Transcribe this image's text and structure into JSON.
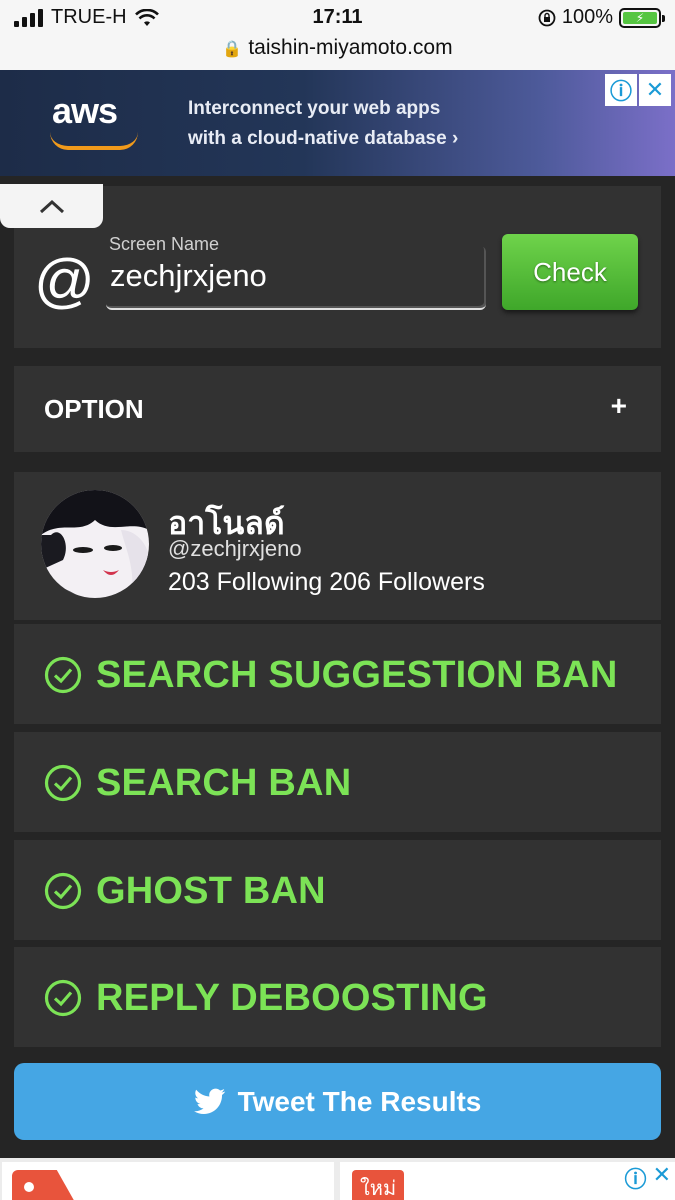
{
  "status_bar": {
    "carrier": "TRUE-H",
    "time": "17:11",
    "battery": "100%",
    "url": "taishin-miyamoto.com"
  },
  "ad_top": {
    "brand": "aws",
    "line1": "Interconnect your web apps",
    "line2": "with a cloud-native database ›",
    "info_icon": "info-icon",
    "close_icon": "close-icon"
  },
  "search": {
    "at_symbol": "@",
    "label": "Screen Name",
    "value": "zechjrxjeno",
    "check_label": "Check"
  },
  "option": {
    "label": "OPTION",
    "toggle": "+"
  },
  "profile": {
    "name": "อาโนลด์",
    "handle": "@zechjrxjeno",
    "stats": "203 Following 206 Followers"
  },
  "results": [
    {
      "label": "SEARCH SUGGESTION BAN",
      "status": "ok"
    },
    {
      "label": "SEARCH BAN",
      "status": "ok"
    },
    {
      "label": "GHOST BAN",
      "status": "ok"
    },
    {
      "label": "REPLY DEBOOSTING",
      "status": "ok"
    }
  ],
  "tweet_button": {
    "label": "Tweet The Results"
  },
  "ad_bottom": {
    "tag": "ใหม่"
  },
  "colors": {
    "result_green": "#7ce356",
    "check_button": "#4fbb34",
    "tweet_blue": "#45a6e4",
    "card_bg": "#323232"
  }
}
